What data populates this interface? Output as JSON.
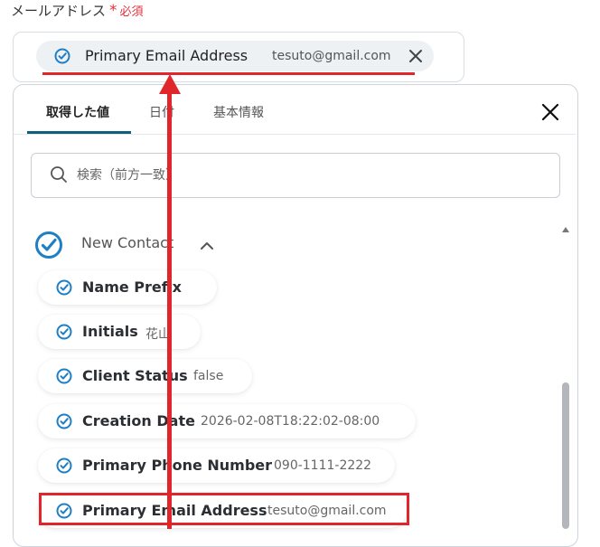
{
  "field": {
    "label": "メールアドレス",
    "required_mark": "*",
    "required_text": "必須",
    "selected": {
      "label": "Primary Email Address",
      "value": "tesuto@gmail.com"
    }
  },
  "tabs": [
    {
      "label": "取得した値",
      "active": true
    },
    {
      "label": "日付",
      "active": false
    },
    {
      "label": "基本情報",
      "active": false
    }
  ],
  "search": {
    "placeholder": "検索（前方一致）",
    "value": ""
  },
  "group": {
    "title": "New Contact",
    "expanded": true
  },
  "items": [
    {
      "label": "Name Prefix",
      "value": ""
    },
    {
      "label": "Initials",
      "value": "花山"
    },
    {
      "label": "Client Status",
      "value": "false"
    },
    {
      "label": "Creation Date",
      "value": "2026-02-08T18:22:02-08:00"
    },
    {
      "label": "Primary Phone Number",
      "value": "090-1111-2222"
    },
    {
      "label": "Primary Email Address",
      "value": "tesuto@gmail.com"
    }
  ],
  "colors": {
    "accent": "#0e5e7e",
    "check_icon": "#1f7fc4",
    "highlight": "#e0252b",
    "required": "#e0323a"
  },
  "icons": {
    "chip": "check-circle-icon",
    "clear": "close-icon",
    "panel_close": "close-icon",
    "search": "search-icon",
    "group": "check-circle-icon",
    "group_toggle": "chevron-up-icon"
  }
}
